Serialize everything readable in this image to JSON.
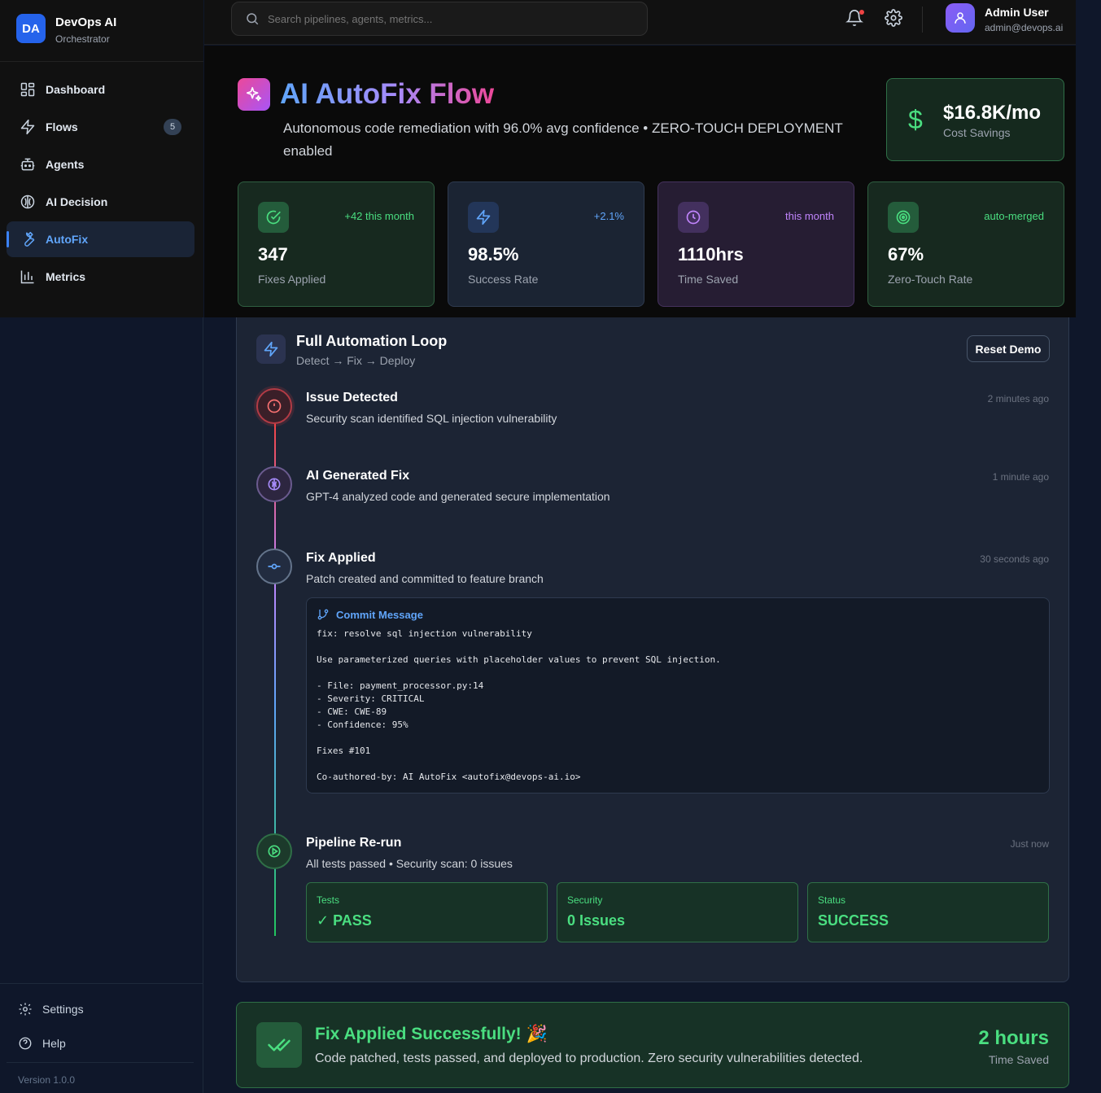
{
  "brand": {
    "logo": "DA",
    "name": "DevOps AI",
    "subtitle": "Orchestrator"
  },
  "nav": [
    {
      "label": "Dashboard",
      "icon": "dashboard-icon"
    },
    {
      "label": "Flows",
      "icon": "zap-icon",
      "badge": "5"
    },
    {
      "label": "Agents",
      "icon": "bot-icon"
    },
    {
      "label": "AI Decision",
      "icon": "brain-icon"
    },
    {
      "label": "AutoFix",
      "icon": "wrench-icon",
      "active": true
    },
    {
      "label": "Metrics",
      "icon": "bar-chart-icon"
    }
  ],
  "sidebar_bottom": {
    "settings": "Settings",
    "help": "Help",
    "version": "Version 1.0.0"
  },
  "search": {
    "placeholder": "Search pipelines, agents, metrics..."
  },
  "user": {
    "name": "Admin User",
    "email": "admin@devops.ai"
  },
  "header": {
    "title": "AI AutoFix Flow",
    "subtitle": "Autonomous code remediation with 96.0% avg confidence • ZERO-TOUCH DEPLOYMENT enabled",
    "savings_value": "$16.8K/mo",
    "savings_label": "Cost Savings"
  },
  "stats": [
    {
      "value": "347",
      "label": "Fixes Applied",
      "delta": "+42 this month",
      "icon": "check-circle-icon",
      "color": "#4ade80"
    },
    {
      "value": "98.5%",
      "label": "Success Rate",
      "delta": "+2.1%",
      "icon": "zap-icon",
      "color": "#60a5fa"
    },
    {
      "value": "1110hrs",
      "label": "Time Saved",
      "delta": "this month",
      "icon": "clock-icon",
      "color": "#c084fc"
    },
    {
      "value": "67%",
      "label": "Zero-Touch Rate",
      "delta": "auto-merged",
      "icon": "target-icon",
      "color": "#4ade80"
    }
  ],
  "loop": {
    "title": "Full Automation Loop",
    "subtitle": "Detect → Fix → Deploy",
    "reset_label": "Reset Demo",
    "steps": [
      {
        "title": "Issue Detected",
        "desc": "Security scan identified SQL injection vulnerability",
        "time": "2 minutes ago"
      },
      {
        "title": "AI Generated Fix",
        "desc": "GPT-4 analyzed code and generated secure implementation",
        "time": "1 minute ago"
      },
      {
        "title": "Fix Applied",
        "desc": "Patch created and committed to feature branch",
        "time": "30 seconds ago"
      },
      {
        "title": "Pipeline Re-run",
        "desc": "All tests passed • Security scan: 0 issues",
        "time": "Just now"
      }
    ],
    "commit": {
      "header": "Commit Message",
      "body": "fix: resolve sql injection vulnerability\n\nUse parameterized queries with placeholder values to prevent SQL injection.\n\n- File: payment_processor.py:14\n- Severity: CRITICAL\n- CWE: CWE-89\n- Confidence: 95%\n\nFixes #101\n\nCo-authored-by: AI AutoFix <autofix@devops-ai.io>"
    },
    "results": [
      {
        "label": "Tests",
        "value": "✓ PASS"
      },
      {
        "label": "Security",
        "value": "0 Issues"
      },
      {
        "label": "Status",
        "value": "SUCCESS"
      }
    ]
  },
  "success": {
    "title": "Fix Applied Successfully! 🎉",
    "desc": "Code patched, tests passed, and deployed to production. Zero security vulnerabilities detected.",
    "value": "2 hours",
    "label": "Time Saved"
  }
}
